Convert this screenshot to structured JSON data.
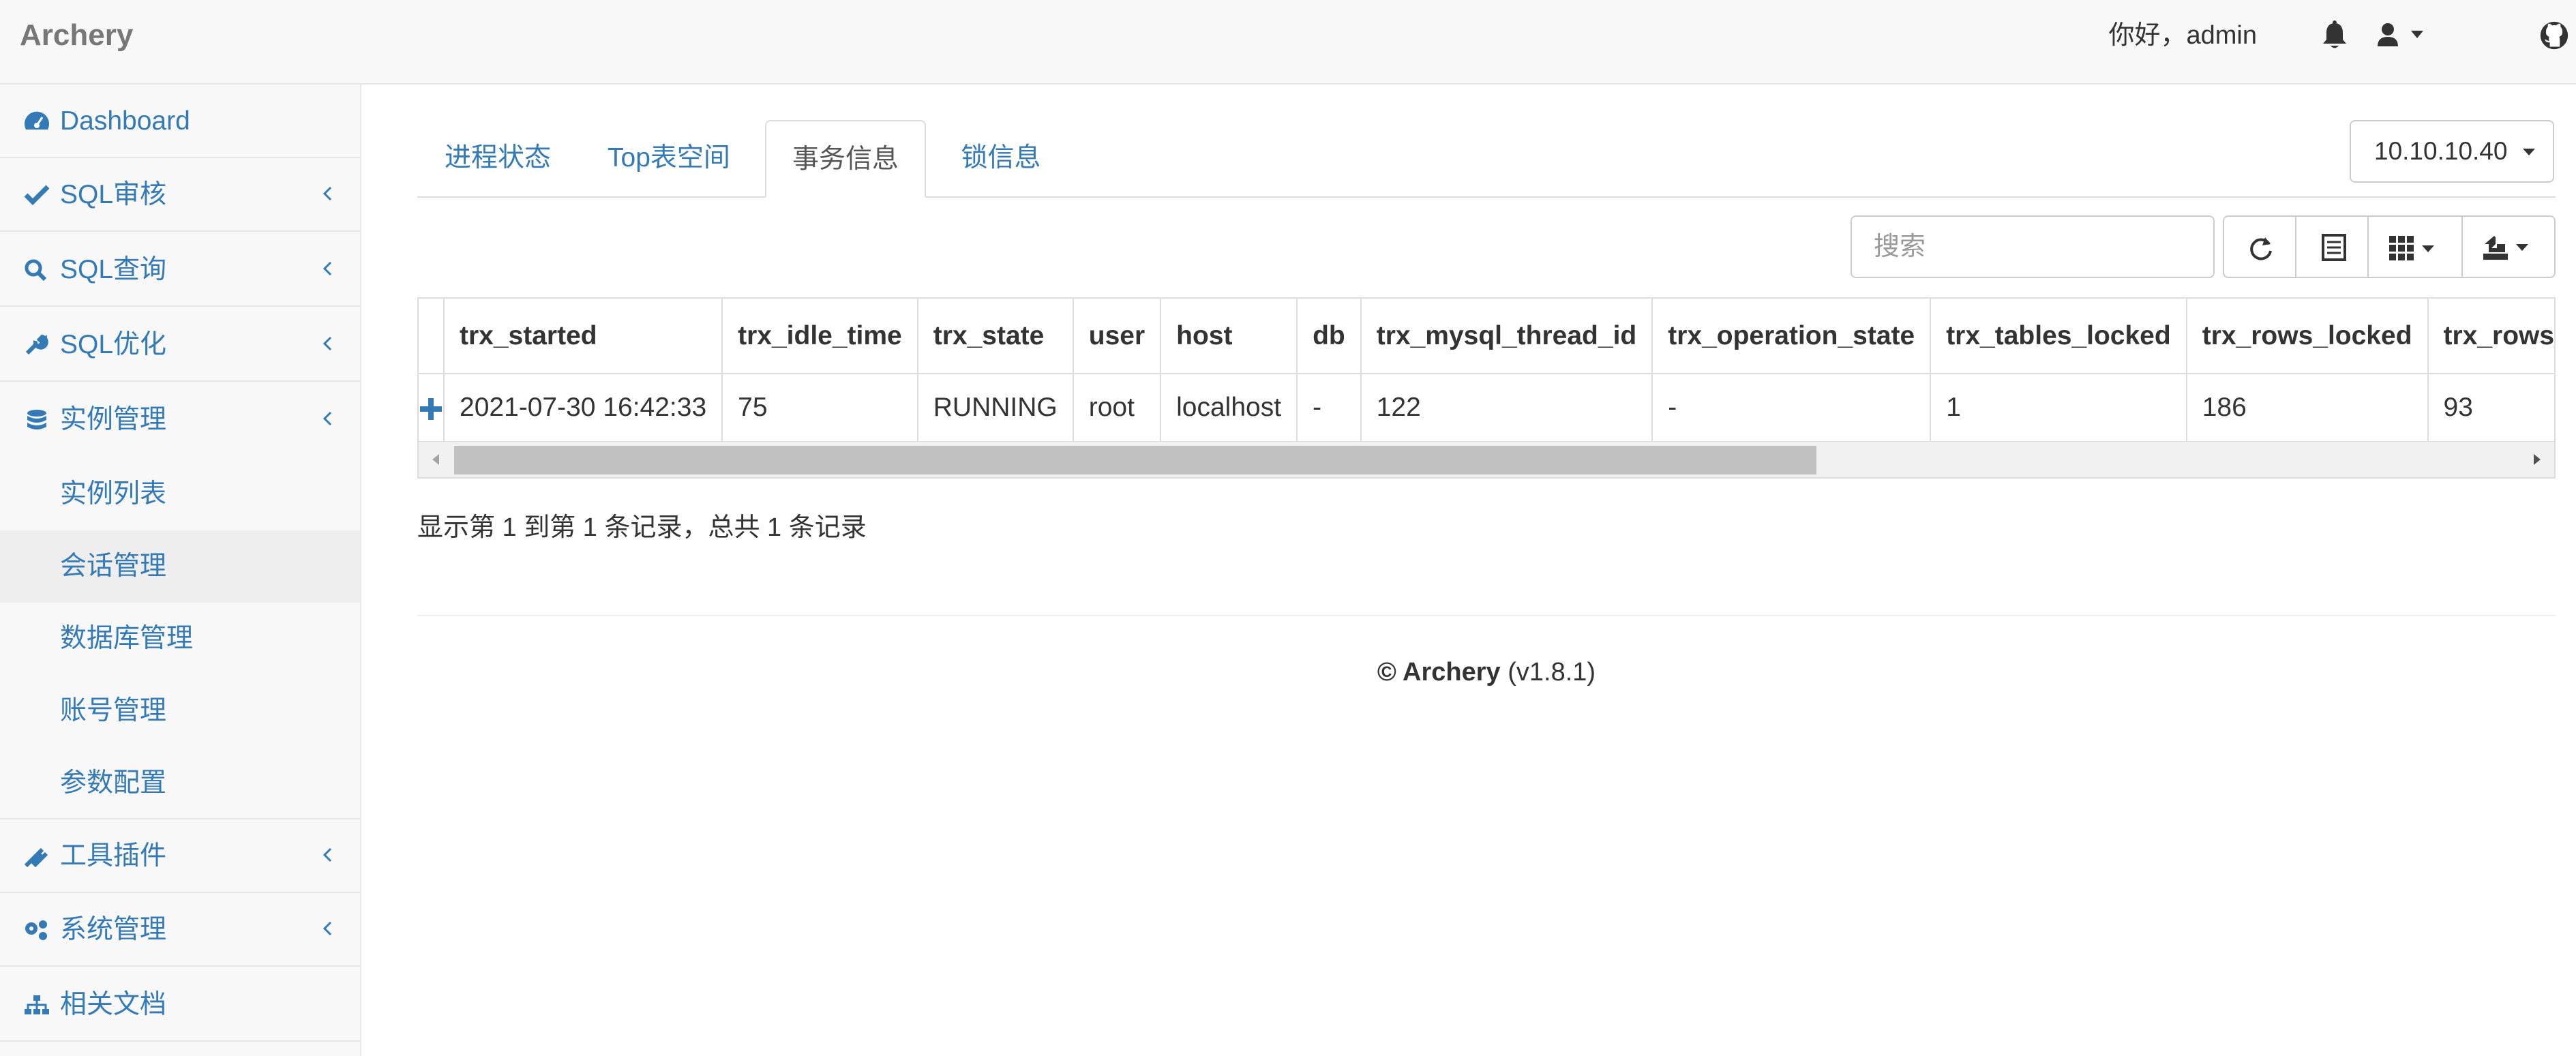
{
  "brand": "Archery",
  "header": {
    "greeting": "你好，admin",
    "icons": [
      "bell-icon",
      "user-icon",
      "github-icon"
    ]
  },
  "sidebar": {
    "items": [
      {
        "label": "Dashboard",
        "icon": "dashboard-icon"
      },
      {
        "label": "SQL审核",
        "icon": "check-icon"
      },
      {
        "label": "SQL查询",
        "icon": "search-icon"
      },
      {
        "label": "SQL优化",
        "icon": "wrench-icon"
      },
      {
        "label": "实例管理",
        "icon": "database-icon"
      }
    ],
    "subitems": [
      "实例列表",
      "会话管理",
      "数据库管理",
      "账号管理",
      "参数配置"
    ],
    "active_subitem": "会话管理",
    "bottom_items": [
      {
        "label": "工具插件",
        "icon": "plug-icon"
      },
      {
        "label": "系统管理",
        "icon": "gears-icon"
      },
      {
        "label": "相关文档",
        "icon": "sitemap-icon"
      }
    ]
  },
  "tabs": [
    "进程状态",
    "Top表空间",
    "事务信息",
    "锁信息"
  ],
  "active_tab": "事务信息",
  "instance_selector": "10.10.10.40",
  "toolbar": {
    "search_placeholder": "搜索",
    "buttons": [
      "refresh-icon",
      "toggle-view-icon",
      "columns-icon",
      "export-icon"
    ]
  },
  "table": {
    "columns": [
      "trx_started",
      "trx_idle_time",
      "trx_state",
      "user",
      "host",
      "db",
      "trx_mysql_thread_id",
      "trx_operation_state",
      "trx_tables_locked",
      "trx_rows_locked",
      "trx_rows_modified"
    ],
    "rows": [
      [
        "2021-07-30 16:42:33",
        "75",
        "RUNNING",
        "root",
        "localhost",
        "-",
        "122",
        "-",
        "1",
        "186",
        "93"
      ]
    ]
  },
  "pagination_info": "显示第 1 到第 1 条记录，总共 1 条记录",
  "footer": {
    "copyright": "© Archery",
    "version": "(v1.8.1)"
  },
  "colors": {
    "link": "#337ab7",
    "topbar_bg": "#f8f8f8",
    "border": "#dddddd"
  }
}
